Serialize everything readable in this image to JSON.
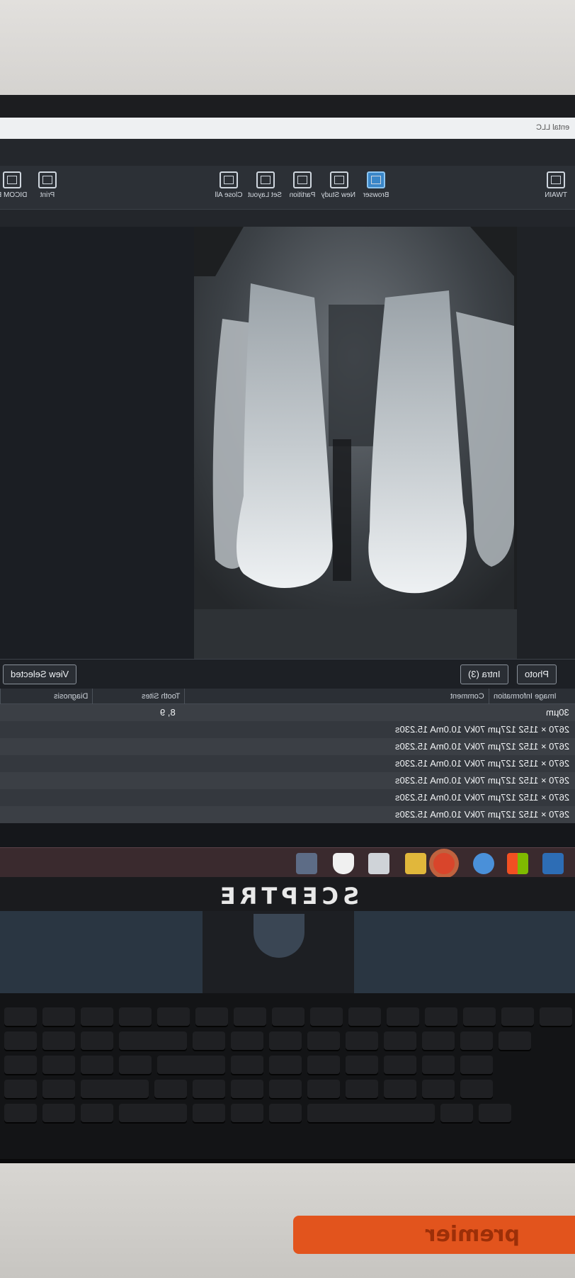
{
  "app": {
    "window_title": "ental LLC"
  },
  "toolbar": {
    "items": [
      {
        "label": "TWAIN",
        "icon": "twain-scanner-icon"
      },
      {
        "label": "Browser",
        "icon": "browser-grid-icon",
        "active": true
      },
      {
        "label": "New Study",
        "icon": "new-study-icon"
      },
      {
        "label": "Partition",
        "icon": "partition-icon"
      },
      {
        "label": "Set Layout",
        "icon": "layout-icon"
      },
      {
        "label": "Close All",
        "icon": "close-all-icon"
      },
      {
        "label": "Print",
        "icon": "printer-icon"
      },
      {
        "label": "DICOM E",
        "icon": "dicom-icon"
      }
    ]
  },
  "tabs": {
    "intra_label": "Intra (3)",
    "photo_label": "Photo",
    "view_selected_label": "View Selected"
  },
  "table": {
    "columns": {
      "image_information": "Image Information",
      "comment": "Comment",
      "tooth_sites": "Tooth Sites",
      "diagnosis": "Diagnosis"
    },
    "rows": [
      {
        "info": "30µm",
        "tooth_sites": "8, 9"
      },
      {
        "info": "2670 × 1152 127µm 70kV 10.0mA 15.230s",
        "tooth_sites": ""
      },
      {
        "info": "2670 × 1152 127µm 70kV 10.0mA 15.230s",
        "tooth_sites": ""
      },
      {
        "info": "2670 × 1152 127µm 70kV 10.0mA 15.230s",
        "tooth_sites": ""
      },
      {
        "info": "2670 × 1152 127µm 70kV 10.0mA 15.230s",
        "tooth_sites": ""
      },
      {
        "info": "2670 × 1152 127µm 70kV 10.0mA 15.230s",
        "tooth_sites": ""
      },
      {
        "info": "2670 × 1152 127µm 70kV 10.0mA 15.230s",
        "tooth_sites": ""
      }
    ]
  },
  "taskbar": {
    "icons": [
      "outlook-icon",
      "windows-store-icon",
      "chat-icon",
      "app-red-icon",
      "file-explorer-icon",
      "notes-icon",
      "tooth-icon",
      "app-r-icon"
    ]
  },
  "monitor": {
    "brand": "SCEPTRE"
  },
  "desk": {
    "tag_text": "premier"
  },
  "colors": {
    "accent": "#3a86c8",
    "tag": "#e2541d"
  }
}
